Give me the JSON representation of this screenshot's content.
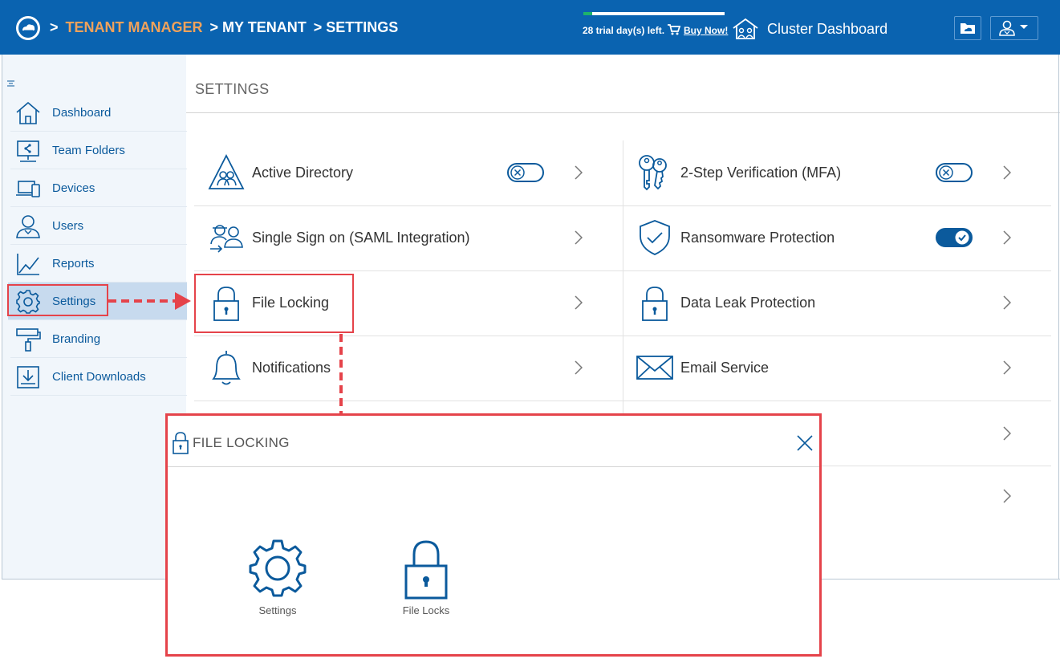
{
  "header": {
    "breadcrumb": [
      {
        "text": ">",
        "style": "sep"
      },
      {
        "text": "TENANT MANAGER",
        "style": "link"
      },
      {
        "text": "> MY TENANT",
        "style": "plain"
      },
      {
        "text": "> SETTINGS",
        "style": "plain"
      }
    ],
    "trial_text": "28 trial day(s) left.",
    "trial_progress": 0.06,
    "buy_now": "Buy Now!",
    "cluster_dashboard": "Cluster Dashboard"
  },
  "sidebar": {
    "items": [
      {
        "label": "Dashboard",
        "icon": "home-icon"
      },
      {
        "label": "Team Folders",
        "icon": "team-folders-icon"
      },
      {
        "label": "Devices",
        "icon": "devices-icon"
      },
      {
        "label": "Users",
        "icon": "users-icon"
      },
      {
        "label": "Reports",
        "icon": "reports-icon"
      },
      {
        "label": "Settings",
        "icon": "gear-icon",
        "active": true
      },
      {
        "label": "Branding",
        "icon": "paint-roller-icon"
      },
      {
        "label": "Client Downloads",
        "icon": "download-icon"
      }
    ]
  },
  "main": {
    "title": "SETTINGS",
    "cards": [
      {
        "label": "Active Directory",
        "icon": "active-directory-icon",
        "toggle": "off"
      },
      {
        "label": "2-Step Verification (MFA)",
        "icon": "keys-icon",
        "toggle": "off"
      },
      {
        "label": "Single Sign on (SAML Integration)",
        "icon": "sso-icon"
      },
      {
        "label": "Ransomware Protection",
        "icon": "shield-icon",
        "toggle": "on"
      },
      {
        "label": "File Locking",
        "icon": "lock-icon"
      },
      {
        "label": "Data Leak Protection",
        "icon": "lock-icon"
      },
      {
        "label": "Notifications",
        "icon": "bell-icon"
      },
      {
        "label": "Email Service",
        "icon": "envelope-icon"
      }
    ]
  },
  "dialog": {
    "title": "FILE LOCKING",
    "items": [
      {
        "label": "Settings",
        "icon": "gear-icon"
      },
      {
        "label": "File Locks",
        "icon": "lock-icon"
      }
    ]
  },
  "colors": {
    "header_bg": "#0a63b0",
    "breadcrumb_link": "#f0a25b",
    "primary": "#0b5a9c",
    "annotation_red": "#e5434a",
    "sidebar_bg": "#f1f6fb",
    "sidebar_active": "#c7daee"
  }
}
